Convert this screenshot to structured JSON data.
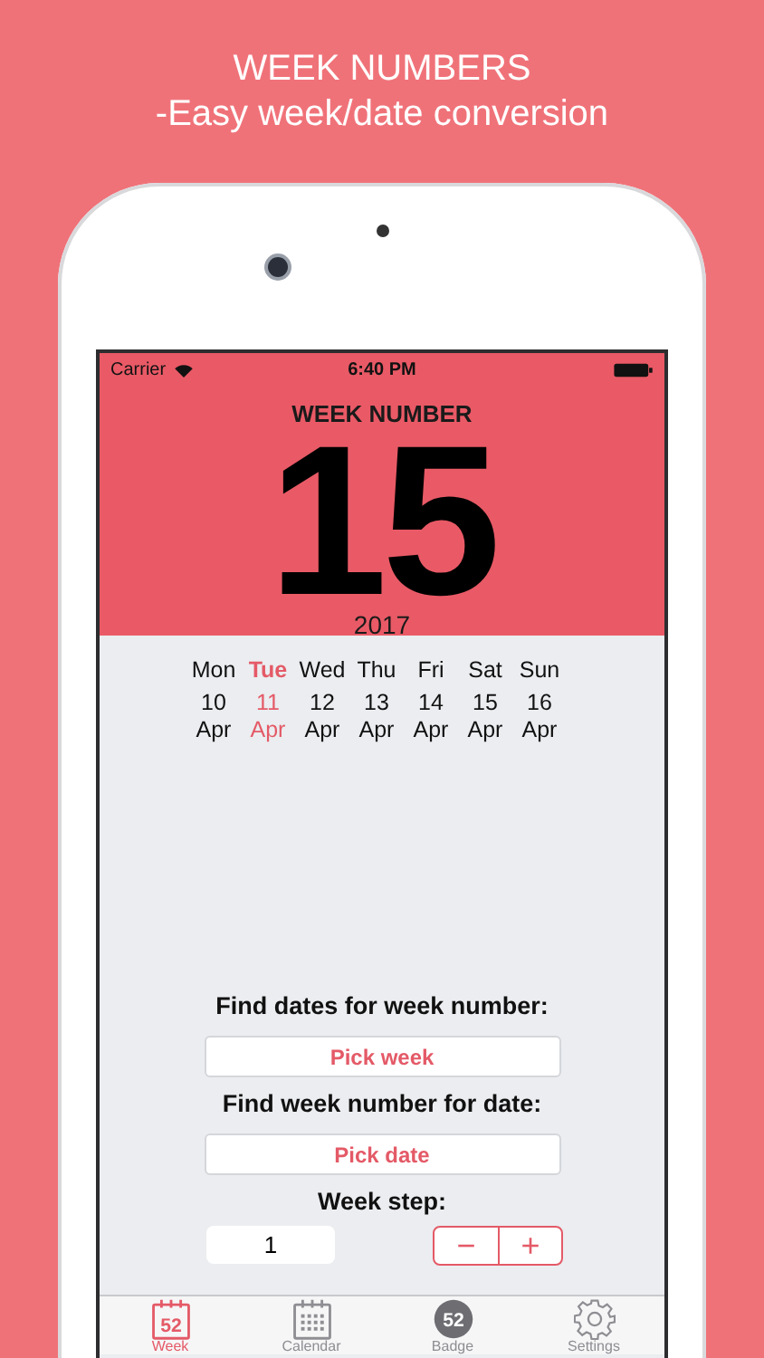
{
  "headline": [
    "WEEK NUMBERS",
    "-Easy week/date conversion"
  ],
  "status_bar": {
    "carrier": "Carrier",
    "time": "6:40 PM"
  },
  "header": {
    "title": "WEEK NUMBER",
    "week": "15",
    "year": "2017"
  },
  "days": [
    {
      "weekday": "Mon",
      "date": "10",
      "month": "Apr",
      "selected": false
    },
    {
      "weekday": "Tue",
      "date": "11",
      "month": "Apr",
      "selected": true
    },
    {
      "weekday": "Wed",
      "date": "12",
      "month": "Apr",
      "selected": false
    },
    {
      "weekday": "Thu",
      "date": "13",
      "month": "Apr",
      "selected": false
    },
    {
      "weekday": "Fri",
      "date": "14",
      "month": "Apr",
      "selected": false
    },
    {
      "weekday": "Sat",
      "date": "15",
      "month": "Apr",
      "selected": false
    },
    {
      "weekday": "Sun",
      "date": "16",
      "month": "Apr",
      "selected": false
    }
  ],
  "find_dates": {
    "label": "Find dates for week number:",
    "button": "Pick week"
  },
  "find_week": {
    "label": "Find week number for date:",
    "button": "Pick date"
  },
  "week_step": {
    "label": "Week step:",
    "value": "1",
    "minus": "−",
    "plus": "+"
  },
  "tabs": [
    {
      "kind": "week",
      "label": "Week",
      "icon_text": "52",
      "selected": true
    },
    {
      "kind": "calendar",
      "label": "Calendar",
      "selected": false
    },
    {
      "kind": "badge",
      "label": "Badge",
      "icon_text": "52",
      "selected": false
    },
    {
      "kind": "settings",
      "label": "Settings",
      "selected": false
    }
  ]
}
